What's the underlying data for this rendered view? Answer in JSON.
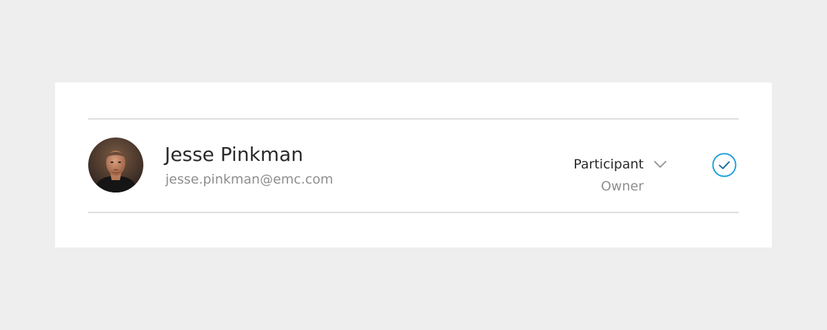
{
  "member": {
    "name": "Jesse Pinkman",
    "email": "jesse.pinkman@emc.com",
    "avatar_icon": "user-photo"
  },
  "role": {
    "current": "Participant",
    "secondary": "Owner",
    "chevron_icon": "chevron-down-icon"
  },
  "status": {
    "icon": "check-circle-icon",
    "accent_color": "#1a9fdb"
  }
}
